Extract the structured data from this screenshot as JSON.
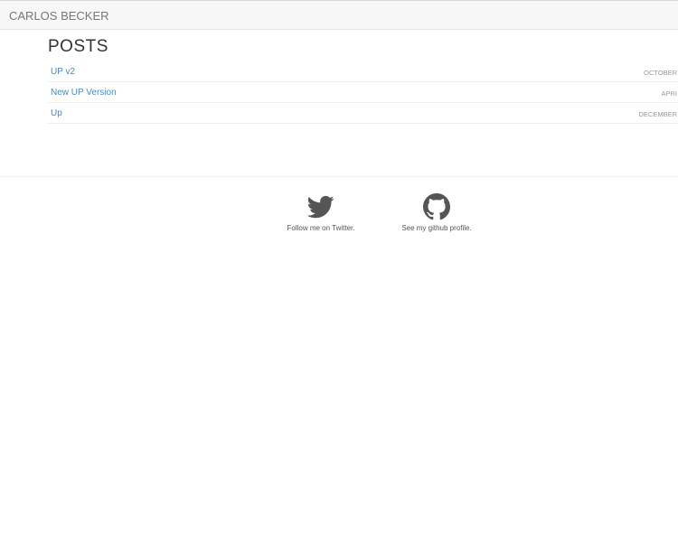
{
  "header": {
    "brand": "CARLOS BECKER"
  },
  "main": {
    "heading": "POSTS",
    "posts": [
      {
        "title": "UP v2",
        "date": "OCTOBER"
      },
      {
        "title": "New UP Version",
        "date": "APRI"
      },
      {
        "title": "Up",
        "date": "DECEMBER"
      }
    ]
  },
  "footer": {
    "twitter": {
      "icon": "twitter-icon",
      "label": "Follow me on Twitter."
    },
    "github": {
      "icon": "github-icon",
      "label": "See my github profile."
    }
  },
  "colors": {
    "link": "#428bca",
    "icon": "#555555"
  }
}
